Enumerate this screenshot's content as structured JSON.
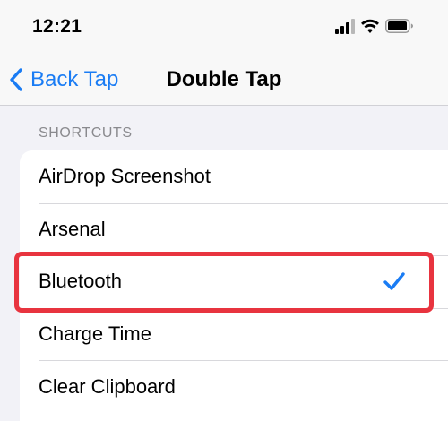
{
  "status_bar": {
    "time": "12:21",
    "icons": [
      "cellular-signal-icon",
      "wifi-icon",
      "battery-icon"
    ]
  },
  "nav": {
    "back_label": "Back Tap",
    "title": "Double Tap"
  },
  "section": {
    "header": "SHORTCUTS"
  },
  "shortcuts": [
    {
      "label": "AirDrop Screenshot",
      "selected": false
    },
    {
      "label": "Arsenal",
      "selected": false
    },
    {
      "label": "Bluetooth",
      "selected": true
    },
    {
      "label": "Charge Time",
      "selected": false
    },
    {
      "label": "Clear Clipboard",
      "selected": false
    }
  ],
  "colors": {
    "accent": "#1a7cf4",
    "highlight": "#e8343f",
    "background": "#f2f2f7"
  }
}
